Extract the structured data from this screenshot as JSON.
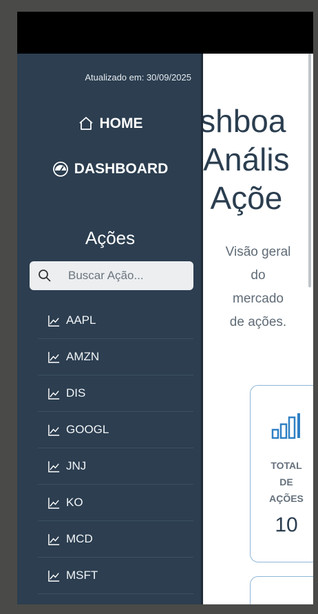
{
  "main": {
    "hero_title": "ashboa\ne Anális\ne Açõe",
    "hero_subtitle": "Visão geral do mercado de ações.",
    "card": {
      "label": "TOTAL\nDE\nAÇÕES",
      "value": "10",
      "icon": "bar-chart-icon"
    }
  },
  "drawer": {
    "updated": "Atualizado em: 30/09/2025",
    "home_label": "HOME",
    "dashboard_label": "DASHBOARD",
    "section_title": "Ações",
    "search_placeholder": "Buscar Ação...",
    "stocks": [
      "AAPL",
      "AMZN",
      "DIS",
      "GOOGL",
      "JNJ",
      "KO",
      "MCD",
      "MSFT"
    ]
  },
  "colors": {
    "drawer_bg": "#2c3e50",
    "accent": "#2f80c4",
    "text_dark": "#2b3e50"
  }
}
